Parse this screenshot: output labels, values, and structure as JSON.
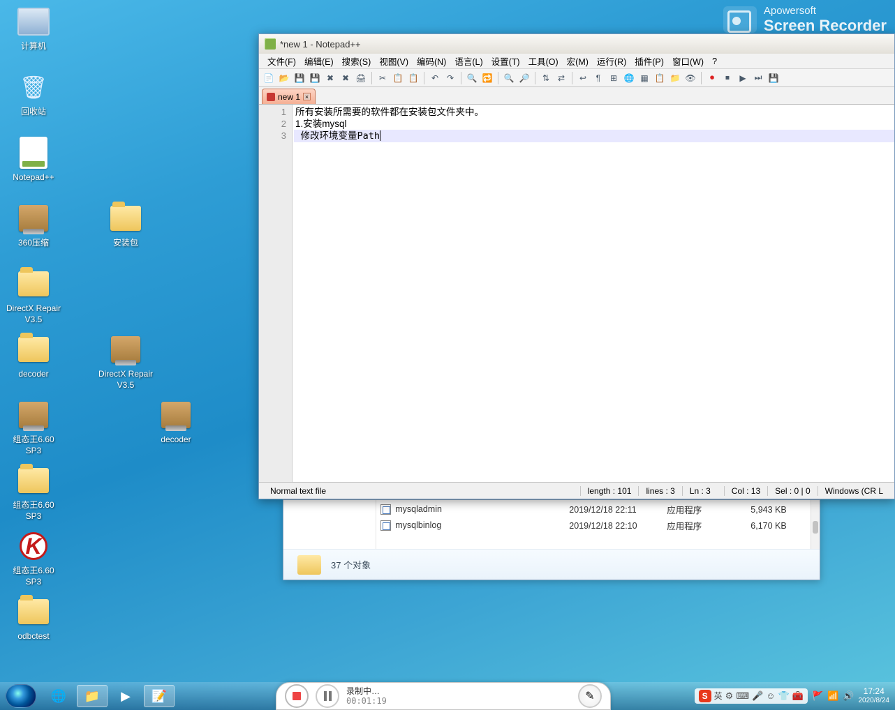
{
  "watermark": {
    "line1": "Apowersoft",
    "line2": "Screen Recorder"
  },
  "desktop": {
    "computer": "计算机",
    "recycle": "回收站",
    "notepadpp": "Notepad++",
    "zip360": "360压缩",
    "directx": "DirectX Repair V3.5",
    "decoder": "decoder",
    "kv660": "组态王6.60 SP3",
    "kv660b": "组态王6.60 SP3",
    "kv660c": "组态王6.60 SP3",
    "odbctest": "odbctest",
    "install_pkg": "安装包",
    "directx_zip": "DirectX Repair V3.5",
    "decoder_zip": "decoder"
  },
  "npp": {
    "title": "*new 1 - Notepad++",
    "menu": {
      "file": "文件(F)",
      "edit": "编辑(E)",
      "search": "搜索(S)",
      "view": "视图(V)",
      "encoding": "编码(N)",
      "language": "语言(L)",
      "settings": "设置(T)",
      "tools": "工具(O)",
      "macro": "宏(M)",
      "run": "运行(R)",
      "plugins": "插件(P)",
      "window": "窗口(W)",
      "help": "?"
    },
    "tab": "new 1",
    "lines": {
      "l1": "所有安装所需要的软件都在安装包文件夹中。",
      "l2": "1.安装mysql",
      "l3a": "  修改环境变量",
      "l3b": "Path"
    },
    "status": {
      "filetype": "Normal text file",
      "length": "length : 101",
      "lines": "lines : 3",
      "ln": "Ln : 3",
      "col": "Col : 13",
      "sel": "Sel : 0 | 0",
      "eol": "Windows (CR L"
    }
  },
  "explorer": {
    "rows": [
      {
        "name": "mysqladmin",
        "date": "2019/12/18 22:11",
        "type": "应用程序",
        "size": "5,943 KB"
      },
      {
        "name": "mysqlbinlog",
        "date": "2019/12/18 22:10",
        "type": "应用程序",
        "size": "6,170 KB"
      }
    ],
    "status": "37 个对象"
  },
  "recorder": {
    "status": "录制中…",
    "duration": "00:01:19"
  },
  "ime": {
    "lang": "英"
  },
  "clock": {
    "time": "17:24",
    "date": "2020/8/24"
  }
}
